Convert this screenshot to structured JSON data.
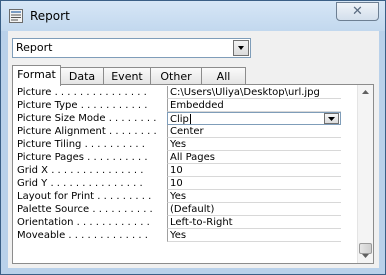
{
  "window": {
    "title": "Report",
    "close_glyph": "✕"
  },
  "selector": {
    "value": "Report"
  },
  "tabs": [
    {
      "label": "Format",
      "active": true
    },
    {
      "label": "Data"
    },
    {
      "label": "Event"
    },
    {
      "label": "Other"
    },
    {
      "label": "All"
    }
  ],
  "properties": [
    {
      "label": "Picture . . . . . . . . . . . . . . .",
      "value": "C:\\Users\\Uliya\\Desktop\\url.jpg"
    },
    {
      "label": "Picture Type . . . . . . . . . . .",
      "value": "Embedded"
    },
    {
      "label": "Picture Size Mode . . . . . . . .",
      "value": "Clip"
    },
    {
      "label": "Picture Alignment . . . . . . . .",
      "value": "Center"
    },
    {
      "label": "Picture Tiling . . . . . . . . . .",
      "value": "Yes"
    },
    {
      "label": "Picture Pages . . . . . . . . . .",
      "value": "All Pages"
    },
    {
      "label": "Grid X . . . . . . . . . . . . . . .",
      "value": "10"
    },
    {
      "label": "Grid Y . . . . . . . . . . . . . . .",
      "value": "10"
    },
    {
      "label": "Layout for Print . . . . . . . . .",
      "value": "Yes"
    },
    {
      "label": "Palette Source . . . . . . . . . .",
      "value": "(Default)"
    },
    {
      "label": "Orientation . . . . . . . . . . . .",
      "value": "Left-to-Right"
    },
    {
      "label": "Moveable . . . . . . . . . . . . .",
      "value": "Yes"
    }
  ],
  "icons": {
    "app": "report-icon",
    "dropdown": "chevron-down-icon",
    "close": "close-icon"
  }
}
